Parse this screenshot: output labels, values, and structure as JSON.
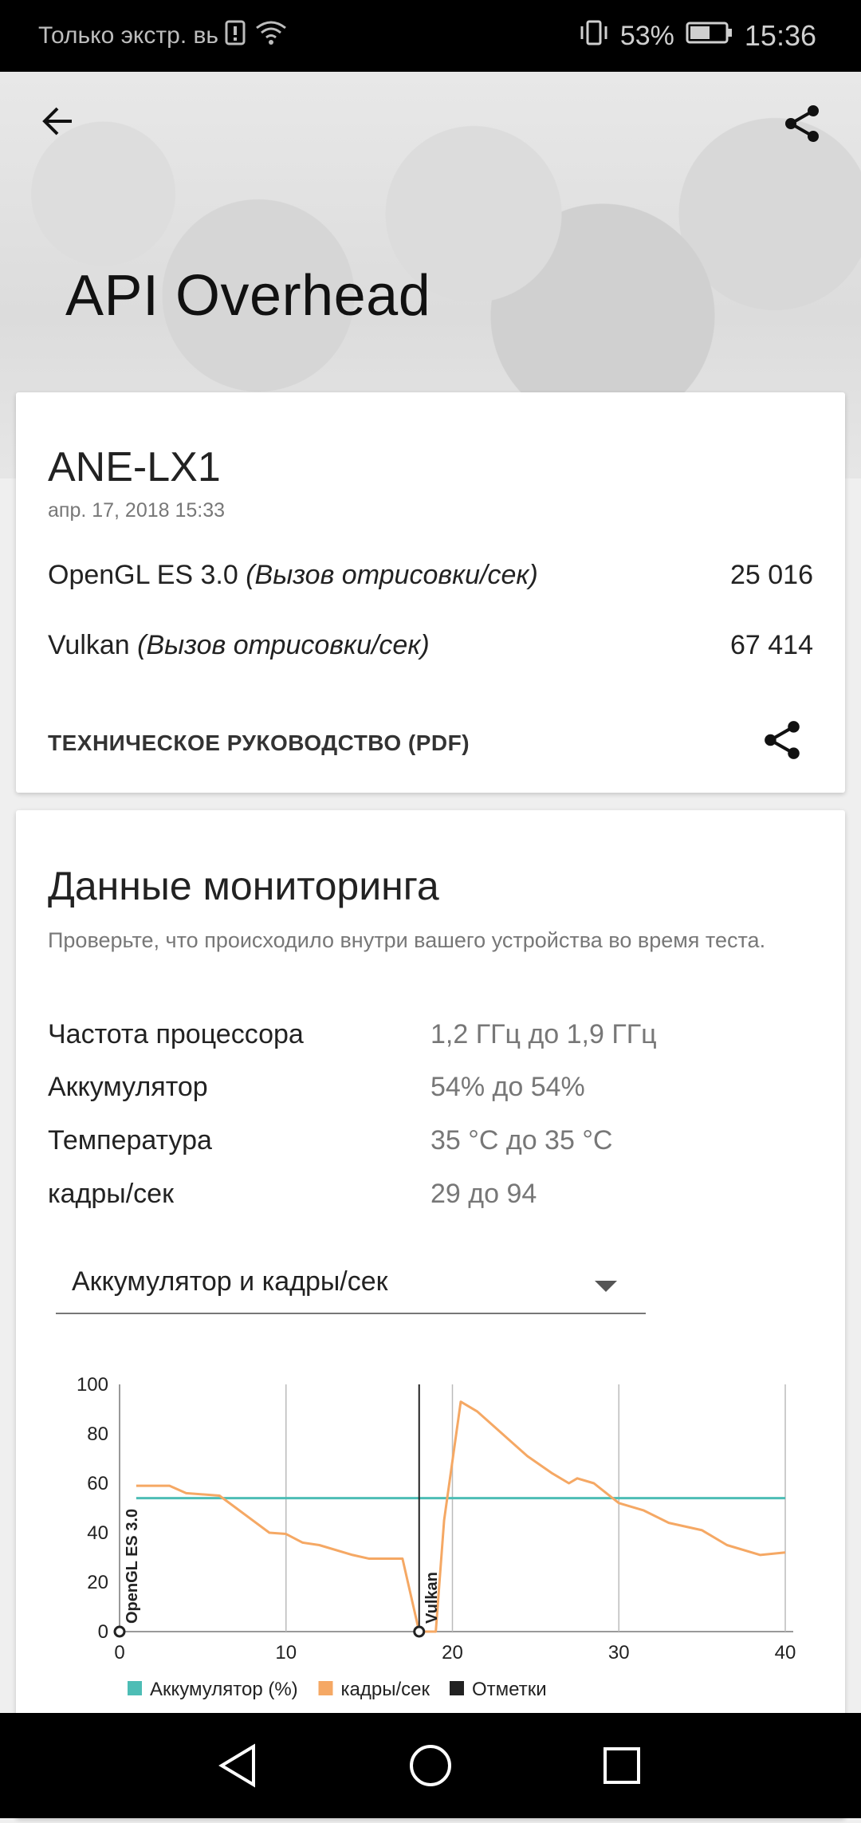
{
  "status_bar": {
    "carrier": "Только экстр. вь",
    "battery_percent": "53%",
    "time": "15:36"
  },
  "header": {
    "title": "API Overhead"
  },
  "result_card": {
    "device": "ANE-LX1",
    "date": "апр. 17, 2018 15:33",
    "rows": [
      {
        "name": "OpenGL ES 3.0",
        "unit": "(Вызов отрисовки/сек)",
        "value": "25 016"
      },
      {
        "name": "Vulkan",
        "unit": "(Вызов отрисовки/сек)",
        "value": "67 414"
      }
    ],
    "guide_label": "ТЕХНИЧЕСКОЕ РУКОВОДСТВО (PDF)"
  },
  "monitoring": {
    "title": "Данные мониторинга",
    "subtitle": "Проверьте, что происходило внутри вашего устройства во время теста.",
    "stats": [
      {
        "label": "Частота процессора",
        "value": "1,2 ГГц до 1,9 ГГц"
      },
      {
        "label": "Аккумулятор",
        "value": "54% до 54%"
      },
      {
        "label": "Температура",
        "value": "35 °C до 35 °C"
      },
      {
        "label": "кадры/сек",
        "value": "29 до 94"
      }
    ],
    "dropdown_selected": "Аккумулятор и кадры/сек"
  },
  "chart_data": {
    "type": "line",
    "xlim": [
      0,
      40
    ],
    "ylim": [
      0,
      100
    ],
    "xticks": [
      "0",
      "10",
      "20",
      "30",
      "40"
    ],
    "yticks": [
      "0",
      "20",
      "40",
      "60",
      "80",
      "100"
    ],
    "series": [
      {
        "name": "Аккумулятор (%)",
        "color": "#4dbdb5",
        "x": [
          1,
          40
        ],
        "y": [
          54,
          54
        ]
      },
      {
        "name": "кадры/сек",
        "color": "#f5a864",
        "x": [
          1,
          3,
          4,
          6,
          7,
          9,
          10,
          11,
          12,
          14,
          15,
          17,
          18,
          19,
          19.5,
          20.5,
          21.5,
          23,
          24.5,
          26,
          27,
          27.5,
          28.5,
          30,
          31.5,
          33,
          35,
          36.5,
          38.5,
          40
        ],
        "y": [
          59,
          59,
          56,
          55,
          50,
          40,
          39.5,
          36,
          35,
          31,
          29.5,
          29.5,
          0,
          0,
          45,
          93,
          89,
          80,
          71,
          64,
          60,
          62,
          60,
          52,
          49,
          44,
          41,
          35,
          31,
          32
        ]
      }
    ],
    "markers": [
      {
        "x": 0,
        "label": "OpenGL ES 3.0"
      },
      {
        "x": 18,
        "label": "Vulkan"
      }
    ],
    "legend": [
      "Аккумулятор (%)",
      "кадры/сек",
      "Отметки"
    ],
    "legend_colors": [
      "#4dbdb5",
      "#f5a864",
      "#222222"
    ]
  }
}
